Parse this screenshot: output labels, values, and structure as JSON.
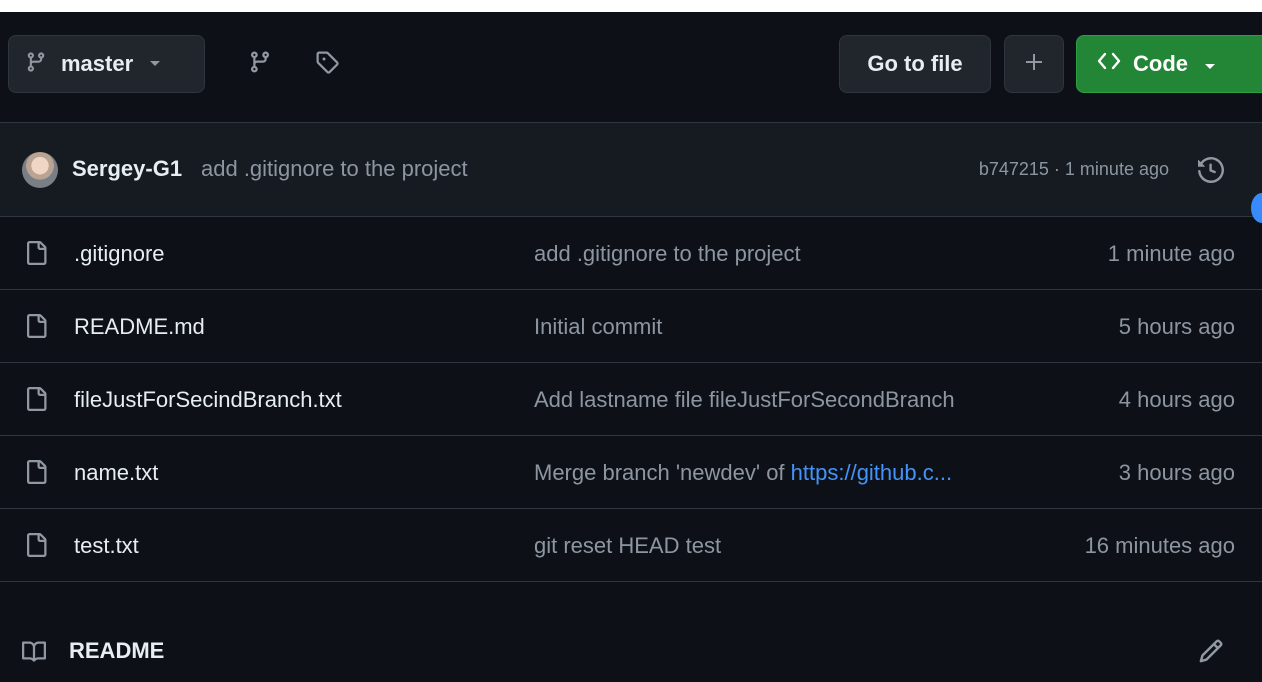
{
  "toolbar": {
    "branch_label": "master",
    "goto_label": "Go to file",
    "code_label": "Code"
  },
  "latest_commit": {
    "author": "Sergey-G1",
    "message": "add .gitignore to the project",
    "meta": "b747215 · 1 minute ago"
  },
  "files": [
    {
      "name": ".gitignore",
      "commit": "add .gitignore to the project",
      "age": "1 minute ago"
    },
    {
      "name": "README.md",
      "commit": "Initial commit",
      "age": "5 hours ago"
    },
    {
      "name": "fileJustForSecindBranch.txt",
      "commit": "Add lastname file fileJustForSecondBranch",
      "age": "4 hours ago"
    },
    {
      "name": "name.txt",
      "commit": "Merge branch 'newdev' of ",
      "commit_link": "https://github.c...",
      "age": "3 hours ago"
    },
    {
      "name": "test.txt",
      "commit": "git reset HEAD test",
      "age": "16 minutes ago"
    }
  ],
  "readme": {
    "title": "README"
  },
  "icons": {
    "branch": "git-branch-icon",
    "branches": "git-branch-icon",
    "tags": "tag-icon",
    "plus": "plus-icon",
    "code": "code-icon",
    "history": "history-icon",
    "file": "file-icon",
    "book": "book-icon",
    "edit": "pencil-icon"
  },
  "colors": {
    "background": "#0d1117",
    "commit_bar": "#161b22",
    "code_button": "#238636",
    "link": "#4493f8",
    "muted_text": "#8d96a0"
  }
}
